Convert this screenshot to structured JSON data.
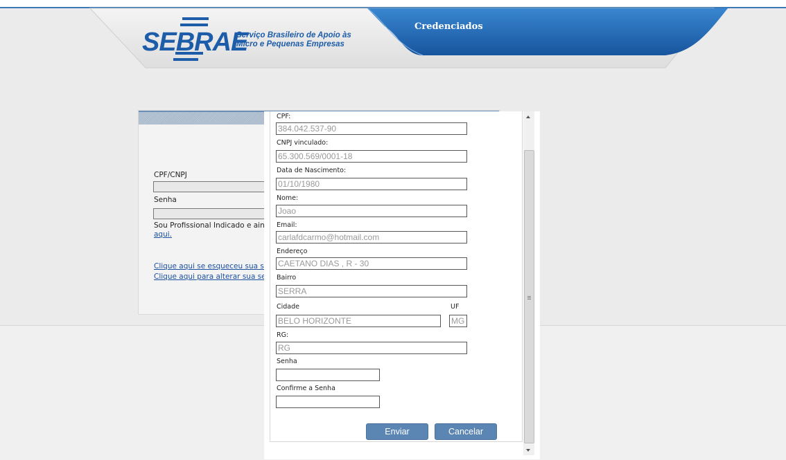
{
  "header": {
    "logo_word": "SEBRAE",
    "logo_tagline_1": "Serviço Brasileiro de Apoio às",
    "logo_tagline_2": "Micro e Pequenas Empresas",
    "tab_label": "Credenciados"
  },
  "login": {
    "cpf_cnpj_label": "CPF/CNPJ",
    "senha_label": "Senha",
    "indicado_text": "Sou Profissional Indicado e ainda",
    "aqui_link": "aqui.",
    "forgot_link": "Clique aqui se esqueceu sua sen",
    "change_link": "Clique aqui para alterar sua senha"
  },
  "form": {
    "cpf": {
      "label": "CPF:",
      "value": "384.042.537-90"
    },
    "cnpj": {
      "label": "CNPJ vinculado:",
      "value": "65.300.569/0001-18"
    },
    "nascimento": {
      "label": "Data de Nascimento:",
      "value": "01/10/1980"
    },
    "nome": {
      "label": "Nome:",
      "value": "Joao"
    },
    "email": {
      "label": "Email:",
      "value": "carlafdcarmo@hotmail.com"
    },
    "endereco": {
      "label": "Endereço",
      "value": "CAETANO DIAS , R - 30"
    },
    "bairro": {
      "label": "Bairro",
      "value": "SERRA"
    },
    "cidade": {
      "label": "Cidade",
      "value": "BELO HORIZONTE"
    },
    "uf": {
      "label": "UF",
      "value": "MG"
    },
    "rg": {
      "label": "RG:",
      "placeholder": "RG"
    },
    "senha": {
      "label": "Senha",
      "value": ""
    },
    "confirme": {
      "label": "Confirme a Senha",
      "value": ""
    },
    "enviar_label": "Enviar",
    "cancelar_label": "Cancelar"
  },
  "colors": {
    "brand_blue": "#1d5ca8",
    "button_blue": "#5b86b4",
    "tab_blue": "#2a6db5"
  }
}
